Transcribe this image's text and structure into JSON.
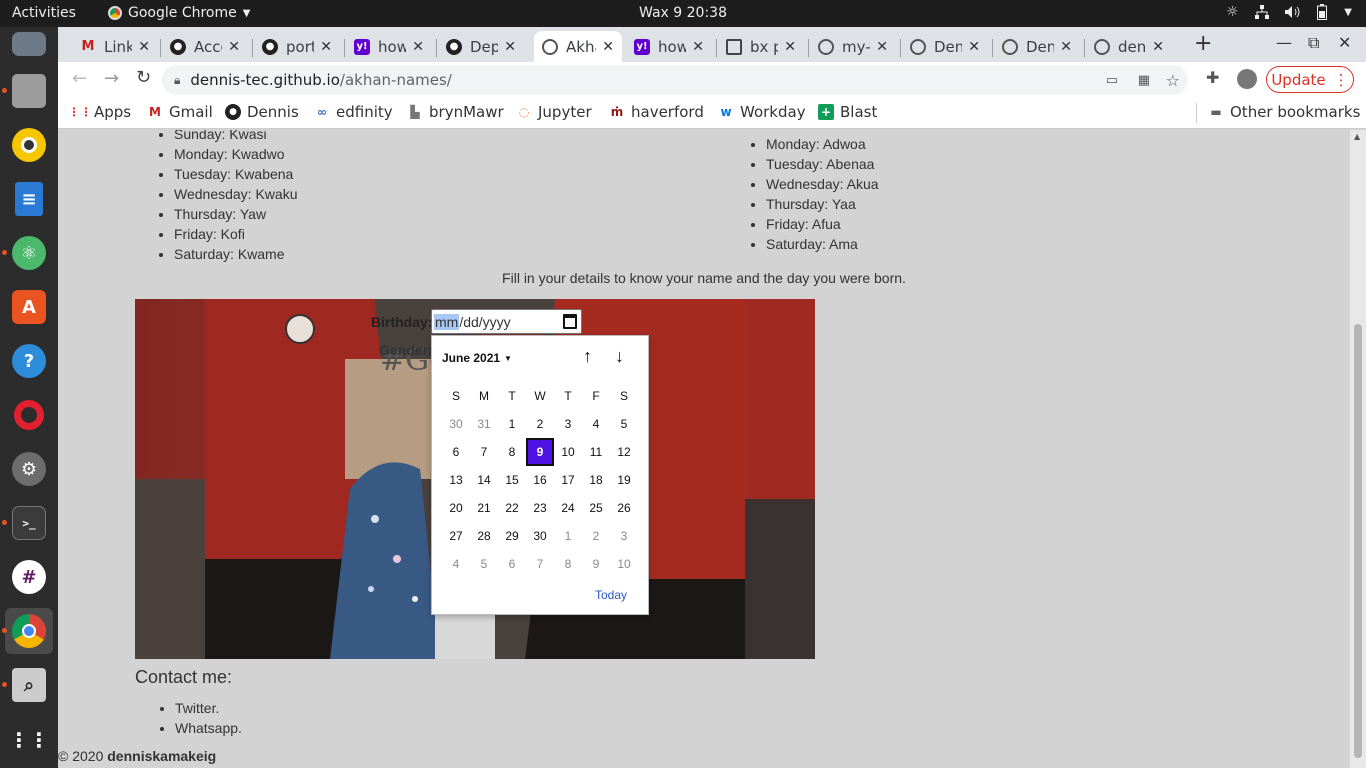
{
  "topbar": {
    "activities": "Activities",
    "app_name": "Google Chrome",
    "clock": "Wax 9  20:38"
  },
  "tabs": [
    {
      "title": "Link",
      "icon": "gmail-icon"
    },
    {
      "title": "Acco",
      "icon": "github-icon"
    },
    {
      "title": "port",
      "icon": "github-icon"
    },
    {
      "title": "how",
      "icon": "yahoo-icon"
    },
    {
      "title": "Dep",
      "icon": "github-icon"
    },
    {
      "title": "Akha",
      "icon": "globe-icon",
      "active": true
    },
    {
      "title": "how",
      "icon": "yahoo-icon"
    },
    {
      "title": "bx p",
      "icon": "book-icon"
    },
    {
      "title": "my-p",
      "icon": "globe-icon"
    },
    {
      "title": "Den",
      "icon": "globe-icon"
    },
    {
      "title": "Den",
      "icon": "globe-icon"
    },
    {
      "title": "denn",
      "icon": "globe-icon"
    }
  ],
  "toolbar": {
    "url_domain": "dennis-tec.github.io",
    "url_path": "/akhan-names/",
    "update_label": "Update"
  },
  "bookmarks": {
    "items": [
      "Apps",
      "Gmail",
      "Dennis",
      "edfinity",
      "brynMawr",
      "Jupyter",
      "haverford",
      "Workday",
      "Blast"
    ],
    "other": "Other bookmarks"
  },
  "page": {
    "male_names": [
      "Sunday: Kwasi",
      "Monday: Kwadwo",
      "Tuesday: Kwabena",
      "Wednesday: Kwaku",
      "Thursday: Yaw",
      "Friday: Kofi",
      "Saturday: Kwame"
    ],
    "female_names": [
      "Monday: Adwoa",
      "Tuesday: Abenaa",
      "Wednesday: Akua",
      "Thursday: Yaa",
      "Friday: Afua",
      "Saturday: Ama"
    ],
    "instructions": "Fill in your details to know your name and the day you were born.",
    "form": {
      "birthday_label": "Birthday:",
      "birthday_mm": "mm",
      "birthday_rest": "/dd/yyyy",
      "gender_label": "Gender:",
      "sign_text": "#Go"
    },
    "picker": {
      "month_label": "June 2021",
      "weekdays": [
        "S",
        "M",
        "T",
        "W",
        "T",
        "F",
        "S"
      ],
      "days": [
        "30",
        "31",
        "1",
        "2",
        "3",
        "4",
        "5",
        "6",
        "7",
        "8",
        "9",
        "10",
        "11",
        "12",
        "13",
        "14",
        "15",
        "16",
        "17",
        "18",
        "19",
        "20",
        "21",
        "22",
        "23",
        "24",
        "25",
        "26",
        "27",
        "28",
        "29",
        "30",
        "1",
        "2",
        "3",
        "4",
        "5",
        "6",
        "7",
        "8",
        "9",
        "10"
      ],
      "selected_day": "9",
      "today_label": "Today"
    },
    "contact_title": "Contact me:",
    "contacts": [
      "Twitter.",
      "Whatsapp."
    ],
    "footer_prefix": "© 2020 ",
    "footer_name": "denniskamakeig"
  },
  "colors": {
    "selected_day": "#4f12e4",
    "link": "#2b57c7",
    "update_border": "#d93025"
  }
}
